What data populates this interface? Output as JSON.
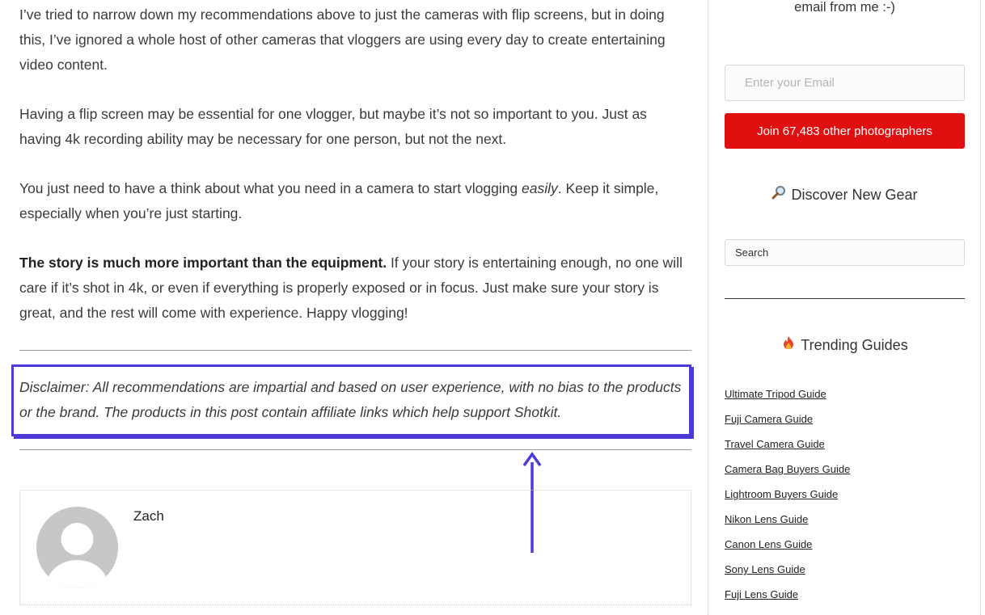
{
  "article": {
    "paragraphs": [
      "I’ve tried to narrow down my recommendations above to just the cameras with flip screens, but in doing this, I’ve ignored a whole host of other cameras that vloggers are using every day to create entertaining video content.",
      "Having a flip screen may be essential for one vlogger, but maybe it’s not so important to you. Just as having 4k recording ability may be necessary for one person, but not the next."
    ],
    "p3_before": "You just need to have a think about what you need in a camera to start vlogging ",
    "p3_em": "easily",
    "p3_after": ". Keep it simple, especially when you’re just starting.",
    "p4_bold": "The story is much more important than the equipment.",
    "p4_rest": " If your story is entertaining enough, no one will care if it’s shot in 4k, or even if everything is properly exposed or in focus. Just make sure your story is great, and the rest will come with experience. Happy vlogging!",
    "disclaimer": "Disclaimer: All recommendations are impartial and based on user experience, with no bias to the products or the brand. The products in this post contain affiliate links which help support Shotkit.",
    "author_name": "Zach",
    "highlight_color": "#4b3ad8"
  },
  "sidebar": {
    "email_note": "email from me :-)",
    "email_placeholder": "Enter your Email",
    "join_button": "Join 67,483 other photographers",
    "join_button_color": "#e01010",
    "discover_title": "Discover New Gear",
    "discover_icon": "magnifier-icon",
    "search_placeholder": "Search",
    "trending_title": "Trending Guides",
    "trending_icon": "fire-icon",
    "guides": [
      "Ultimate Tripod Guide",
      "Fuji Camera Guide",
      "Travel Camera Guide",
      "Camera Bag Buyers Guide",
      "Lightroom Buyers Guide",
      "Nikon Lens Guide",
      "Canon Lens Guide",
      "Sony Lens Guide",
      "Fuji Lens Guide"
    ]
  }
}
